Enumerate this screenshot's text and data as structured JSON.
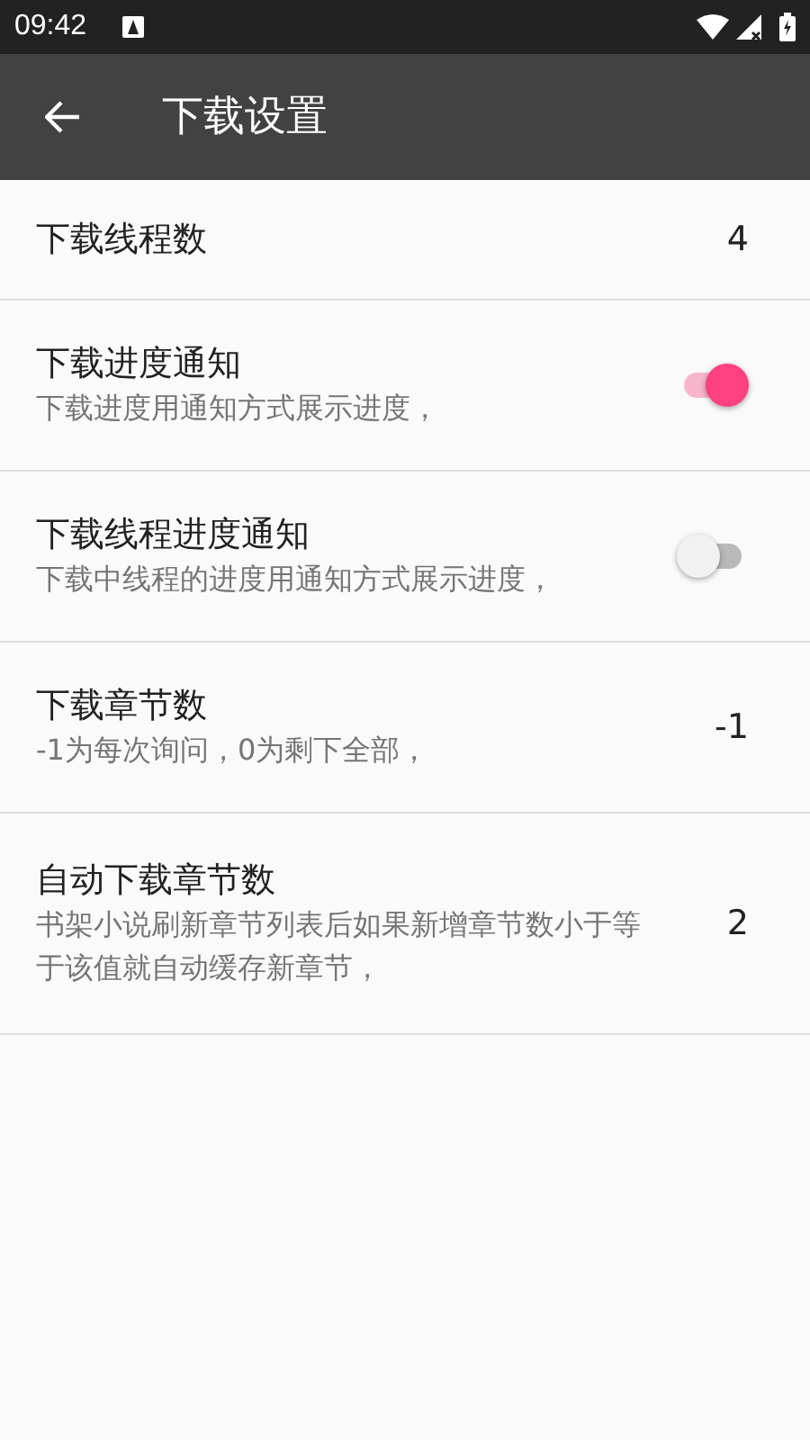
{
  "status_bar": {
    "time": "09:42"
  },
  "app_bar": {
    "title": "下载设置"
  },
  "settings": [
    {
      "kind": "value",
      "title": "下载线程数",
      "value": "4"
    },
    {
      "kind": "switch",
      "title": "下载进度通知",
      "summary": "下载进度用通知方式展示进度，",
      "on": true
    },
    {
      "kind": "switch",
      "title": "下载线程进度通知",
      "summary": "下载中线程的进度用通知方式展示进度，",
      "on": false
    },
    {
      "kind": "value",
      "title": "下载章节数",
      "summary": "-1为每次询问，0为剩下全部，",
      "value": "-1"
    },
    {
      "kind": "value",
      "title": "自动下载章节数",
      "summary": "书架小说刷新章节列表后如果新增章节数小于等于该值就自动缓存新章节，",
      "value": "2"
    }
  ]
}
